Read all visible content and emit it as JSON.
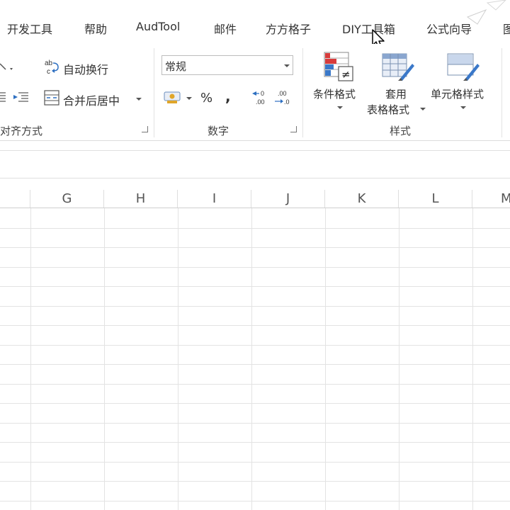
{
  "menu": {
    "tabs": [
      "开发工具",
      "帮助",
      "AudTool",
      "邮件",
      "方方格子",
      "DIY工具箱",
      "公式向导",
      "图"
    ]
  },
  "ribbon": {
    "alignment": {
      "wrap_text": "自动换行",
      "merge_center": "合并后居中",
      "group_label": "对齐方式"
    },
    "number": {
      "format_value": "常规",
      "percent": "%",
      "comma": ",",
      "group_label": "数字"
    },
    "styles": {
      "conditional_format": "条件格式",
      "table_format_line1": "套用",
      "table_format_line2": "表格格式",
      "cell_styles": "单元格样式",
      "group_label": "样式"
    }
  },
  "sheet": {
    "columns": [
      "G",
      "H",
      "I",
      "J",
      "K",
      "L",
      "M"
    ]
  },
  "colors": {
    "grid_line": "#e3e3e3",
    "accent_red": "#d83b3b",
    "accent_blue": "#3a78c9"
  }
}
